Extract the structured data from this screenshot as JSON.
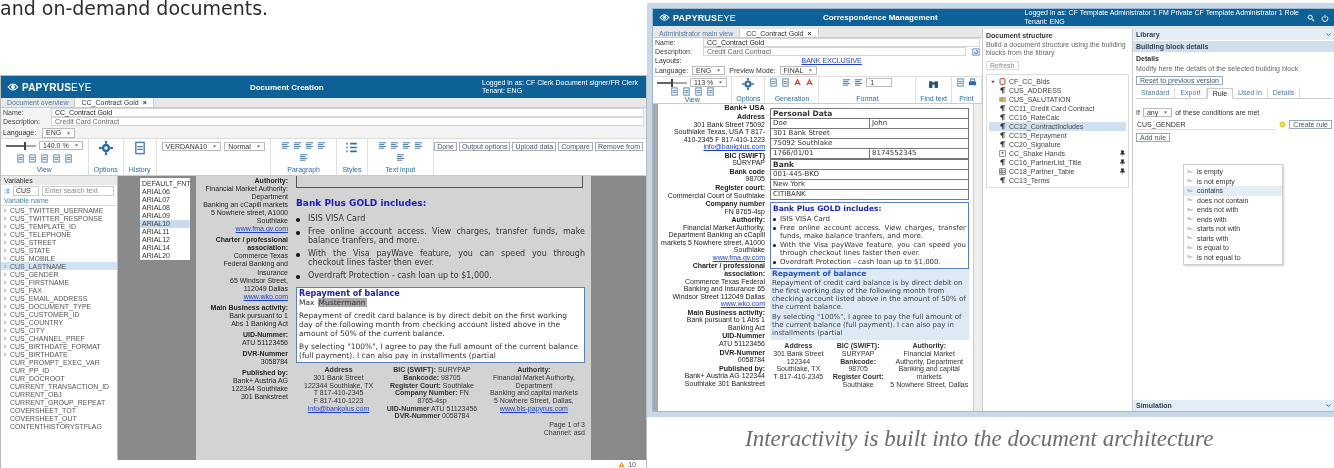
{
  "intro_text": "and on-demand documents.",
  "document_creation": {
    "header": {
      "logo_bold": "PAPYRUS",
      "logo_light": "EYE",
      "title": "Document Creation",
      "user": "Logged in as: CF Clerk  Document signer/FR Clerk",
      "tenant": "Tenant: ENG"
    },
    "tabs": [
      {
        "label": "Document overview",
        "selected": false
      },
      {
        "label": "CC_Contract Gold",
        "selected": true,
        "close": "×"
      }
    ],
    "fields": [
      {
        "label": "Name:",
        "value": "CC_Contract Gold"
      },
      {
        "label": "Description:",
        "value": "Credit Card Contract"
      }
    ],
    "language": {
      "label": "Language:",
      "value": "ENG"
    },
    "toolbar": {
      "zoom": "140.0 %",
      "zoom_slider": {
        "level": 0.6
      },
      "groups": [
        "View",
        "Options",
        "History",
        "Paragraph",
        "Styles",
        "Text input"
      ],
      "font": "VERDANA10",
      "style": "Normal",
      "font_list": [
        {
          "label": "DEFAULT_FNT",
          "selected": false
        },
        {
          "label": "ARIAL06",
          "selected": false
        },
        {
          "label": "ARIAL07",
          "selected": false
        },
        {
          "label": "ARIAL08",
          "selected": false
        },
        {
          "label": "ARIAL09",
          "selected": false
        },
        {
          "label": "ARIAL10",
          "selected": true
        },
        {
          "label": "ARIAL11",
          "selected": false
        },
        {
          "label": "ARIAL12",
          "selected": false
        },
        {
          "label": "ARIAL14",
          "selected": false
        },
        {
          "label": "ARIAL20",
          "selected": false
        }
      ],
      "actions": [
        "Done",
        "Output options",
        "Upload data",
        "Compare",
        "Remove from"
      ]
    },
    "variables": {
      "title": "Variables",
      "search_value": "CUS",
      "search_placeholder": "Enter search text",
      "column": "Variable name",
      "items": [
        {
          "name": "CUS_TWITTER_USERNAME",
          "expandable": true,
          "selected": false
        },
        {
          "name": "CUS_TWITTER_RESPONSE",
          "expandable": true,
          "selected": false
        },
        {
          "name": "CUS_TEMPLATE_ID",
          "expandable": true,
          "selected": false
        },
        {
          "name": "CUS_TELEPHONE",
          "expandable": true,
          "selected": false
        },
        {
          "name": "CUS_STREET",
          "expandable": true,
          "selected": false
        },
        {
          "name": "CUS_STATE",
          "expandable": true,
          "selected": false
        },
        {
          "name": "CUS_MOBILE",
          "expandable": true,
          "selected": false
        },
        {
          "name": "CUS_LASTNAME",
          "expandable": true,
          "selected": true
        },
        {
          "name": "CUS_GENDER",
          "expandable": true,
          "selected": false
        },
        {
          "name": "CUS_FIRSTNAME",
          "expandable": true,
          "selected": false
        },
        {
          "name": "CUS_FAX",
          "expandable": true,
          "selected": false
        },
        {
          "name": "CUS_EMAIL_ADDRESS",
          "expandable": true,
          "selected": false
        },
        {
          "name": "CUS_DOCUMENT_TYPE",
          "expandable": true,
          "selected": false
        },
        {
          "name": "CUS_CUSTOMER_ID",
          "expandable": true,
          "selected": false
        },
        {
          "name": "CUS_COUNTRY",
          "expandable": true,
          "selected": false
        },
        {
          "name": "CUS_CITY",
          "expandable": true,
          "selected": false
        },
        {
          "name": "CUS_CHANNEL_PREF",
          "expandable": true,
          "selected": false
        },
        {
          "name": "CUS_BIRTHDATE_FORMAT",
          "expandable": true,
          "selected": false
        },
        {
          "name": "CUS_BIRTHDATE",
          "expandable": true,
          "selected": false
        },
        {
          "name": "CUR_PROMPT_EXEC_VAR",
          "expandable": false,
          "selected": false
        },
        {
          "name": "CUR_PP_ID",
          "expandable": false,
          "selected": false
        },
        {
          "name": "CUR_DOCROOT",
          "expandable": false,
          "selected": false
        },
        {
          "name": "CURRENT_TRANSACTION_ID",
          "expandable": false,
          "selected": false
        },
        {
          "name": "CURRENT_OBJ",
          "expandable": false,
          "selected": false
        },
        {
          "name": "CURRENT_GROUP_REPEAT",
          "expandable": false,
          "selected": false
        },
        {
          "name": "COVERSHEET_TOT",
          "expandable": false,
          "selected": false
        },
        {
          "name": "COVERSHEET_OUT",
          "expandable": false,
          "selected": false
        },
        {
          "name": "CONTENTHISTORYSTFLAG",
          "expandable": false,
          "selected": false
        }
      ]
    },
    "document": {
      "sidebar": [
        {
          "heading": "Authority:",
          "lines": [
            "Financial Market Authority:",
            "Department",
            "Banking an cCapill markets",
            "5 Nowhere street, A1000 Southlake"
          ],
          "link": "www.fma.gv.com"
        },
        {
          "heading": "Charter / professional association:",
          "lines": [
            "Commerce Texas",
            "Federal Banking and Insurance",
            "65 Windsor Street,",
            "112049 Dallas"
          ],
          "link": "www.wko.com"
        },
        {
          "heading": "Main Business activity:",
          "lines": [
            "Bank pursuant to 1",
            "Abs 1 Banking Act"
          ]
        },
        {
          "heading": "UID-Nummer:",
          "lines": [
            "ATU 51123456"
          ]
        },
        {
          "heading": "DVR-Nummer",
          "lines": [
            "3058784"
          ]
        },
        {
          "heading": "Published by:",
          "lines": [
            "Bank+ Austria AG",
            "122344 Southlake",
            "301 Bankstreet"
          ]
        }
      ],
      "box_title": "Bank Plus GOLD includes:",
      "bullets": [
        "ISIS VISA Card",
        "Free online account access.  View charges, transfer funds, make balance tranfers, and more.",
        "With the Visa payWave feature, you can speed you through checkout lines faster then ever.",
        "Overdraft Protection - cash loan up to $1,000."
      ],
      "repayment": {
        "title": "Repayment of balance",
        "first_name": "Max",
        "last_name": "Mustermann",
        "paragraphs": [
          "Repayment of credit card balance is by direct debit on the first working day of the following month from checking account listed above in the amount of 50% of the current balance.",
          "By selecting \"100%\", I agree to pay the full amount of the current balance (full payment).  I can also pay in installments (partial"
        ]
      },
      "footer": [
        {
          "lines": [
            "**Address**",
            "301 Bank Street",
            "122344 Southlake, TX",
            "T 817-410-2345",
            "F 817-410-1223"
          ],
          "link": "info@bankplus.com"
        },
        {
          "lines": [
            "**BIC (SWIFT):** SURYPAP",
            "**Bankcode:** 98705",
            "**Register Court:** Southlake",
            "**Company Number:** FN 8765-4sp",
            "**UID-Nummer** ATU 51123456",
            "**DVR-Nummer** 0058784"
          ]
        },
        {
          "lines": [
            "**Authority:**",
            "Financial Market Authority, Department",
            "Banking and capital markets",
            "5 Nowhere Street, Dallas,"
          ],
          "link": "www.bls-papyrus.com"
        }
      ],
      "page": "Page 1 of 3",
      "channel": "Channel: asd"
    },
    "status_count": "10"
  },
  "correspondence": {
    "header": {
      "logo_bold": "PAPYRUS",
      "logo_light": "EYE",
      "title": "Correspondence Management",
      "user": "Logged in as: CF Template Administrator 1   FM Private CF Template Administrator 1 Role",
      "tenant": "Tenant: ENG"
    },
    "tabs": [
      {
        "label": "Administrator main view",
        "selected": false
      },
      {
        "label": "CC_Contract Gold",
        "selected": true,
        "close": "×"
      }
    ],
    "fields": [
      {
        "label": "Name:",
        "value": "CC_Contract Gold"
      },
      {
        "label": "Description:",
        "value": "Credit Card Contract"
      }
    ],
    "layouts": {
      "label": "Layouts:",
      "link": "BANK EXCLUSIVE"
    },
    "language": {
      "label": "Language:",
      "value": "ENG"
    },
    "preview": {
      "label": "Preview Mode:",
      "value": "FINAL"
    },
    "toolbar": {
      "zoom": "113 %",
      "zoom_slider": {
        "level": 0.45
      },
      "spin_value": "1",
      "groups": [
        "View",
        "Options",
        "Generation",
        "Format",
        "Find text",
        "Print"
      ]
    },
    "document": {
      "bank": "Bank+ USA",
      "sidebar": [
        {
          "heading": "Address",
          "text": "301 Bank Street 75092 Southlake Texas, USA T 817-410-2345 F 817-410-1223",
          "link": "info@bankplus.com"
        },
        {
          "heading": "BIC (SWIFT)",
          "text": "SURYPAP"
        },
        {
          "heading": "Bank code",
          "text": "98705"
        },
        {
          "heading": "Register court:",
          "text": "Commercial Court of Southlake"
        },
        {
          "heading": "Company number",
          "text": "FN 8765-4sp"
        },
        {
          "heading": "Authority:",
          "text": "Financial Market Authority, Department Banking an cCapill markets 5 Nowhere street, A1000 Southlake",
          "link": "www.fma.gv.com"
        },
        {
          "heading": "Charter / professional association:",
          "text": "Commerce Texas Federal Banking and Insurance 65 Windsor Street 112049 Dallas",
          "link": "www.wko.com"
        },
        {
          "heading": "Main Business activity:",
          "text": "Bank pursuant to 1 Abs 1 Banking Act"
        },
        {
          "heading": "UID-Nummer",
          "text": "ATU 51123456"
        },
        {
          "heading": "DVR-Nummer",
          "text": "0058784"
        },
        {
          "heading": "Published by:",
          "text": "Bank+ Austria AG 122344 Southlake 301 Bankstreet"
        }
      ],
      "form": [
        {
          "kind": "heading",
          "title": "Personal Data"
        },
        {
          "kind": "row",
          "values": [
            "Doe",
            "John"
          ]
        },
        {
          "kind": "row",
          "values": [
            "301 Bank Street"
          ]
        },
        {
          "kind": "row",
          "values": [
            "75092 Southlake"
          ]
        },
        {
          "kind": "row",
          "values": [
            "1766/01/01",
            "8174552345"
          ]
        },
        {
          "kind": "heading",
          "title": "Bank"
        },
        {
          "kind": "row",
          "values": [
            "001-445-BKO"
          ]
        },
        {
          "kind": "row",
          "values": [
            "New York"
          ]
        },
        {
          "kind": "row",
          "values": [
            "CITIBANK"
          ]
        }
      ],
      "box_title": "Bank Plus GOLD includes:",
      "bullets": [
        "ISIS VISA Card",
        "Free online account access.  View charges, transfer funds, make balance tranfers, and more.",
        "With the Visa payWave feature, you can speed you through checkout lines faster then ever.",
        "Overdraft Protection - cash loan up to $1,000."
      ],
      "repayment": {
        "title": "Repayment of balance",
        "paragraphs": [
          "Repayment of credit card balance is by direct debit on the first working day of the following month from checking account listed above in the amount of 50% of the current balance.",
          "By selecting \"100%\", I agree to pay the full amount of the current balance (full payment).  I can also pay in installments (partial"
        ]
      },
      "footer": [
        {
          "lines": [
            "**Address**",
            "301 Bank Street",
            "122344 Southlake, TX",
            "T 817-410-2345"
          ]
        },
        {
          "lines": [
            "**BIC (SWIFT):** SURYPAP",
            "**Bankcode:** 98705",
            "**Register Court:** Southlake"
          ]
        },
        {
          "lines": [
            "**Authority:**",
            "Financial Market Authority, Department",
            "Banking and capital markets",
            "5 Nowhere Street, Dallas"
          ]
        }
      ]
    },
    "structure": {
      "title": "Document structure",
      "description": "Build a document structure using the building blocks from the library",
      "refresh": "Refresh",
      "tree": {
        "label": "CF_CC_Blds",
        "expanded": true,
        "children": [
          {
            "label": "CUS_ADDRESS",
            "kind": "paragraph",
            "selected": false,
            "pinned": false
          },
          {
            "label": "CUS_SALUTATION",
            "kind": "address",
            "selected": false,
            "pinned": false
          },
          {
            "label": "CC11_Credit Card Contract",
            "kind": "paragraph",
            "selected": false,
            "pinned": false
          },
          {
            "label": "CC16_RateCalc",
            "kind": "paragraph",
            "selected": false,
            "pinned": false
          },
          {
            "label": "CC12_ContractIncludes",
            "kind": "paragraph",
            "selected": true,
            "pinned": false
          },
          {
            "label": "CC15_Repayment",
            "kind": "paragraph",
            "selected": false,
            "pinned": false
          },
          {
            "label": "CC20_Signature",
            "kind": "paragraph",
            "selected": false,
            "pinned": false
          },
          {
            "label": "CC_Shake Hands",
            "kind": "image",
            "selected": false,
            "pinned": true
          },
          {
            "label": "CC16_PartnerList_Title",
            "kind": "paragraph",
            "selected": false,
            "pinned": true
          },
          {
            "label": "CC18_Partner_Table",
            "kind": "table",
            "selected": false,
            "pinned": true
          },
          {
            "label": "CC13_Terms",
            "kind": "paragraph",
            "selected": false,
            "pinned": false
          }
        ]
      }
    },
    "details": {
      "library": "Library",
      "block_details": "Building block details",
      "details_title": "Details",
      "details_text": "Modify here the details of the selected building block",
      "reset": "Reset to previous version",
      "tabs": [
        {
          "label": "Standard",
          "selected": false
        },
        {
          "label": "Export",
          "selected": false
        },
        {
          "label": "Rule",
          "selected": true
        },
        {
          "label": "Used in",
          "selected": false
        },
        {
          "label": "Details",
          "selected": false
        }
      ],
      "rule": {
        "prefix": "If",
        "quantifier": "any",
        "suffix": "of these conditions are met",
        "field": "CUS_GENDER",
        "create": "Create rule",
        "add": "Add rule"
      },
      "operators": [
        {
          "label": "is empty",
          "selected": false
        },
        {
          "label": "is not empty",
          "selected": false
        },
        {
          "label": "contains",
          "selected": true
        },
        {
          "label": "does not contain",
          "selected": false
        },
        {
          "label": "ends not with",
          "selected": false
        },
        {
          "label": "ends with",
          "selected": false
        },
        {
          "label": "starts not with",
          "selected": false
        },
        {
          "label": "starts with",
          "selected": false
        },
        {
          "label": "is equal to",
          "selected": false
        },
        {
          "label": "is not equal to",
          "selected": false
        }
      ],
      "simulation": "Simulation"
    }
  },
  "caption": "Interactivity is built into the document architecture"
}
